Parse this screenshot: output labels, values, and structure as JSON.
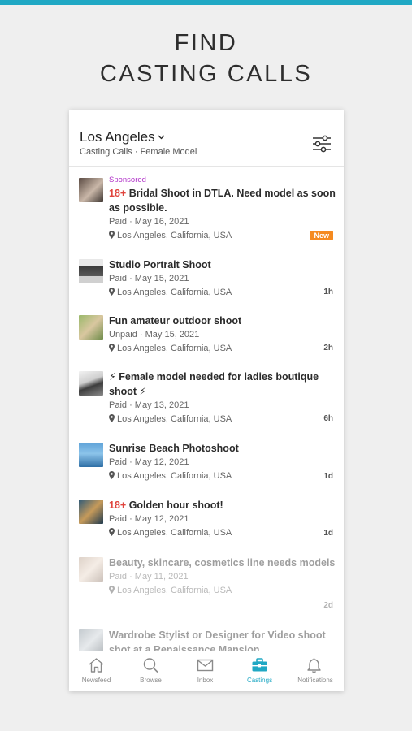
{
  "promo": {
    "line1": "FIND",
    "line2": "CASTING CALLS"
  },
  "header": {
    "city": "Los Angeles",
    "subtitle": "Casting Calls · Female Model"
  },
  "listings": [
    {
      "sponsored": "Sponsored",
      "adult": "18+",
      "title": "Bridal Shoot in DTLA. Need model as soon as possible.",
      "meta": "Paid · May 16, 2021",
      "location": "Los Angeles, California, USA",
      "badge": "New"
    },
    {
      "title": "Studio Portrait Shoot",
      "meta": "Paid · May 15, 2021",
      "location": "Los Angeles, California, USA",
      "age": "1h"
    },
    {
      "title": "Fun amateur outdoor shoot",
      "meta": "Unpaid · May 15, 2021",
      "location": "Los Angeles, California, USA",
      "age": "2h"
    },
    {
      "title": "⚡ Female model needed for ladies boutique shoot ⚡",
      "meta": "Paid · May 13, 2021",
      "location": "Los Angeles, California, USA",
      "age": "6h"
    },
    {
      "title": "Sunrise Beach Photoshoot",
      "meta": "Paid · May 12, 2021",
      "location": "Los Angeles, California, USA",
      "age": "1d"
    },
    {
      "adult": "18+",
      "title": "Golden hour shoot!",
      "meta": "Paid · May 12, 2021",
      "location": "Los Angeles, California, USA",
      "age": "1d"
    },
    {
      "title": "Beauty, skincare, cosmetics line needs models",
      "meta": "Paid · May 11, 2021",
      "location": "Los Angeles, California, USA",
      "age": "2d"
    },
    {
      "title": "Wardrobe Stylist or Designer for Video shoot shot at a Renaissance Mansion"
    }
  ],
  "tabs": [
    {
      "label": "Newsfeed",
      "icon": "home-icon"
    },
    {
      "label": "Browse",
      "icon": "search-icon"
    },
    {
      "label": "Inbox",
      "icon": "mail-icon"
    },
    {
      "label": "Castings",
      "icon": "briefcase-icon",
      "active": true
    },
    {
      "label": "Notifications",
      "icon": "bell-icon"
    }
  ],
  "colors": {
    "accent": "#20a8c4",
    "adult": "#e0453e",
    "sponsored": "#b030c8",
    "new_badge": "#f58a1f"
  }
}
